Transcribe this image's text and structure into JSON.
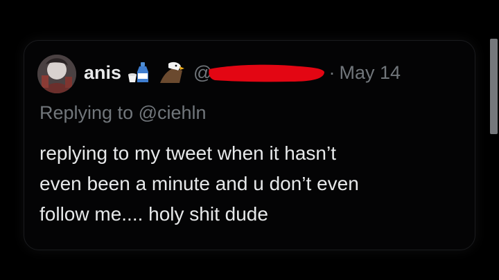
{
  "post": {
    "author_name": "anis",
    "handle_visible": "@",
    "separator": "·",
    "date": "May 14",
    "reply_prefix": "Replying to",
    "reply_to": "@ciehln",
    "text_lines": [
      "replying to my tweet when it hasn’t",
      "even been a minute and u don’t even",
      "follow me.... holy shit dude"
    ],
    "badge_icons": [
      "sake-bottle-icon",
      "eagle-icon"
    ]
  },
  "colors": {
    "background": "#000000",
    "text_primary": "#e7e9ea",
    "text_secondary": "#71767b",
    "redaction": "#e30613"
  }
}
